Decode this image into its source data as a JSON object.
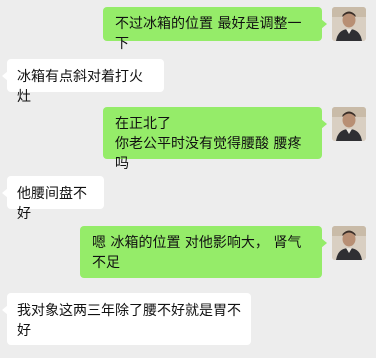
{
  "colors": {
    "background": "#ededed",
    "sent_bubble": "#95ec69",
    "received_bubble": "#ffffff",
    "text": "#111111"
  },
  "messages": [
    {
      "side": "sent",
      "text": "不过冰箱的位置 最好是调整一下",
      "avatar": "user-avatar"
    },
    {
      "side": "received",
      "text": "冰箱有点斜对着打火灶"
    },
    {
      "side": "sent",
      "text": "在正北了\n你老公平时没有觉得腰酸 腰疼吗",
      "avatar": "user-avatar"
    },
    {
      "side": "received",
      "text": "他腰间盘不好"
    },
    {
      "side": "sent",
      "text": "嗯 冰箱的位置 对他影响大， 肾气不足",
      "avatar": "user-avatar"
    },
    {
      "side": "received",
      "text": "我对象这两三年除了腰不好就是胃不好"
    }
  ]
}
